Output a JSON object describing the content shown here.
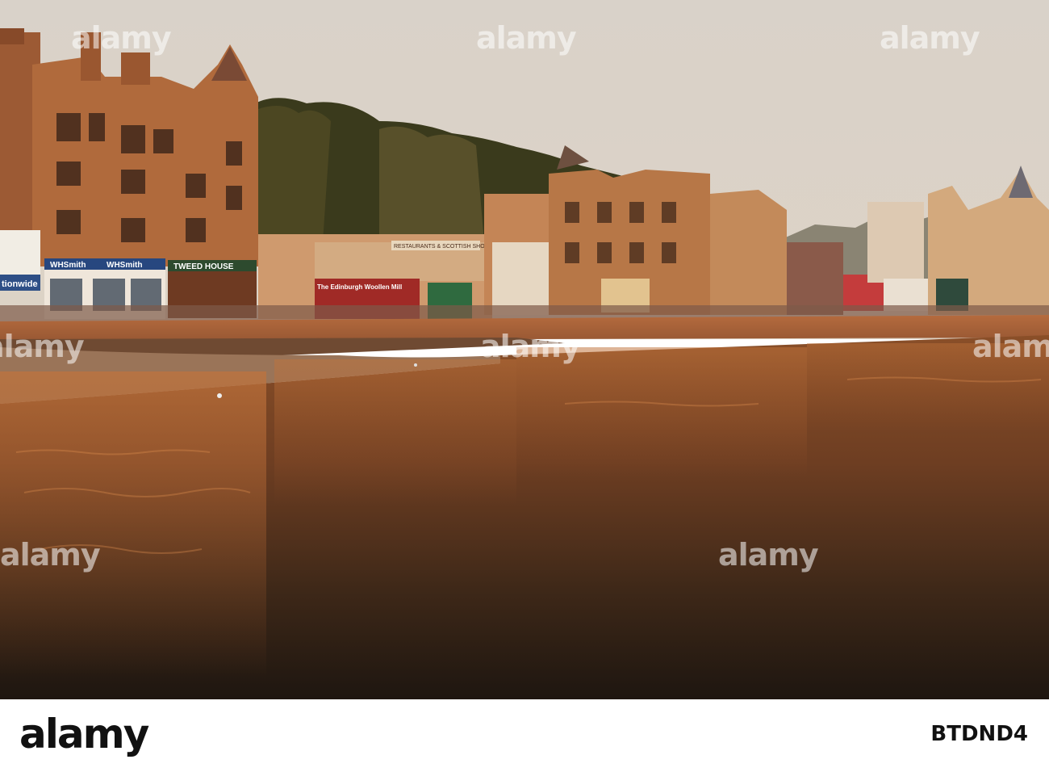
{
  "photo": {
    "signs": {
      "nationwide": "tionwide",
      "whsmith_1": "WHSmith",
      "whsmith_2": "WHSmith",
      "tweed_house": "TWEED    HOUSE",
      "edinburgh_woollen_mill": "The Edinburgh Woollen Mill",
      "restaurants": "RESTAURANTS & SCOTTISH SHOW"
    }
  },
  "watermark": {
    "text": "alamy"
  },
  "footer": {
    "logo": "alamy",
    "image_id": "BTDND4"
  }
}
